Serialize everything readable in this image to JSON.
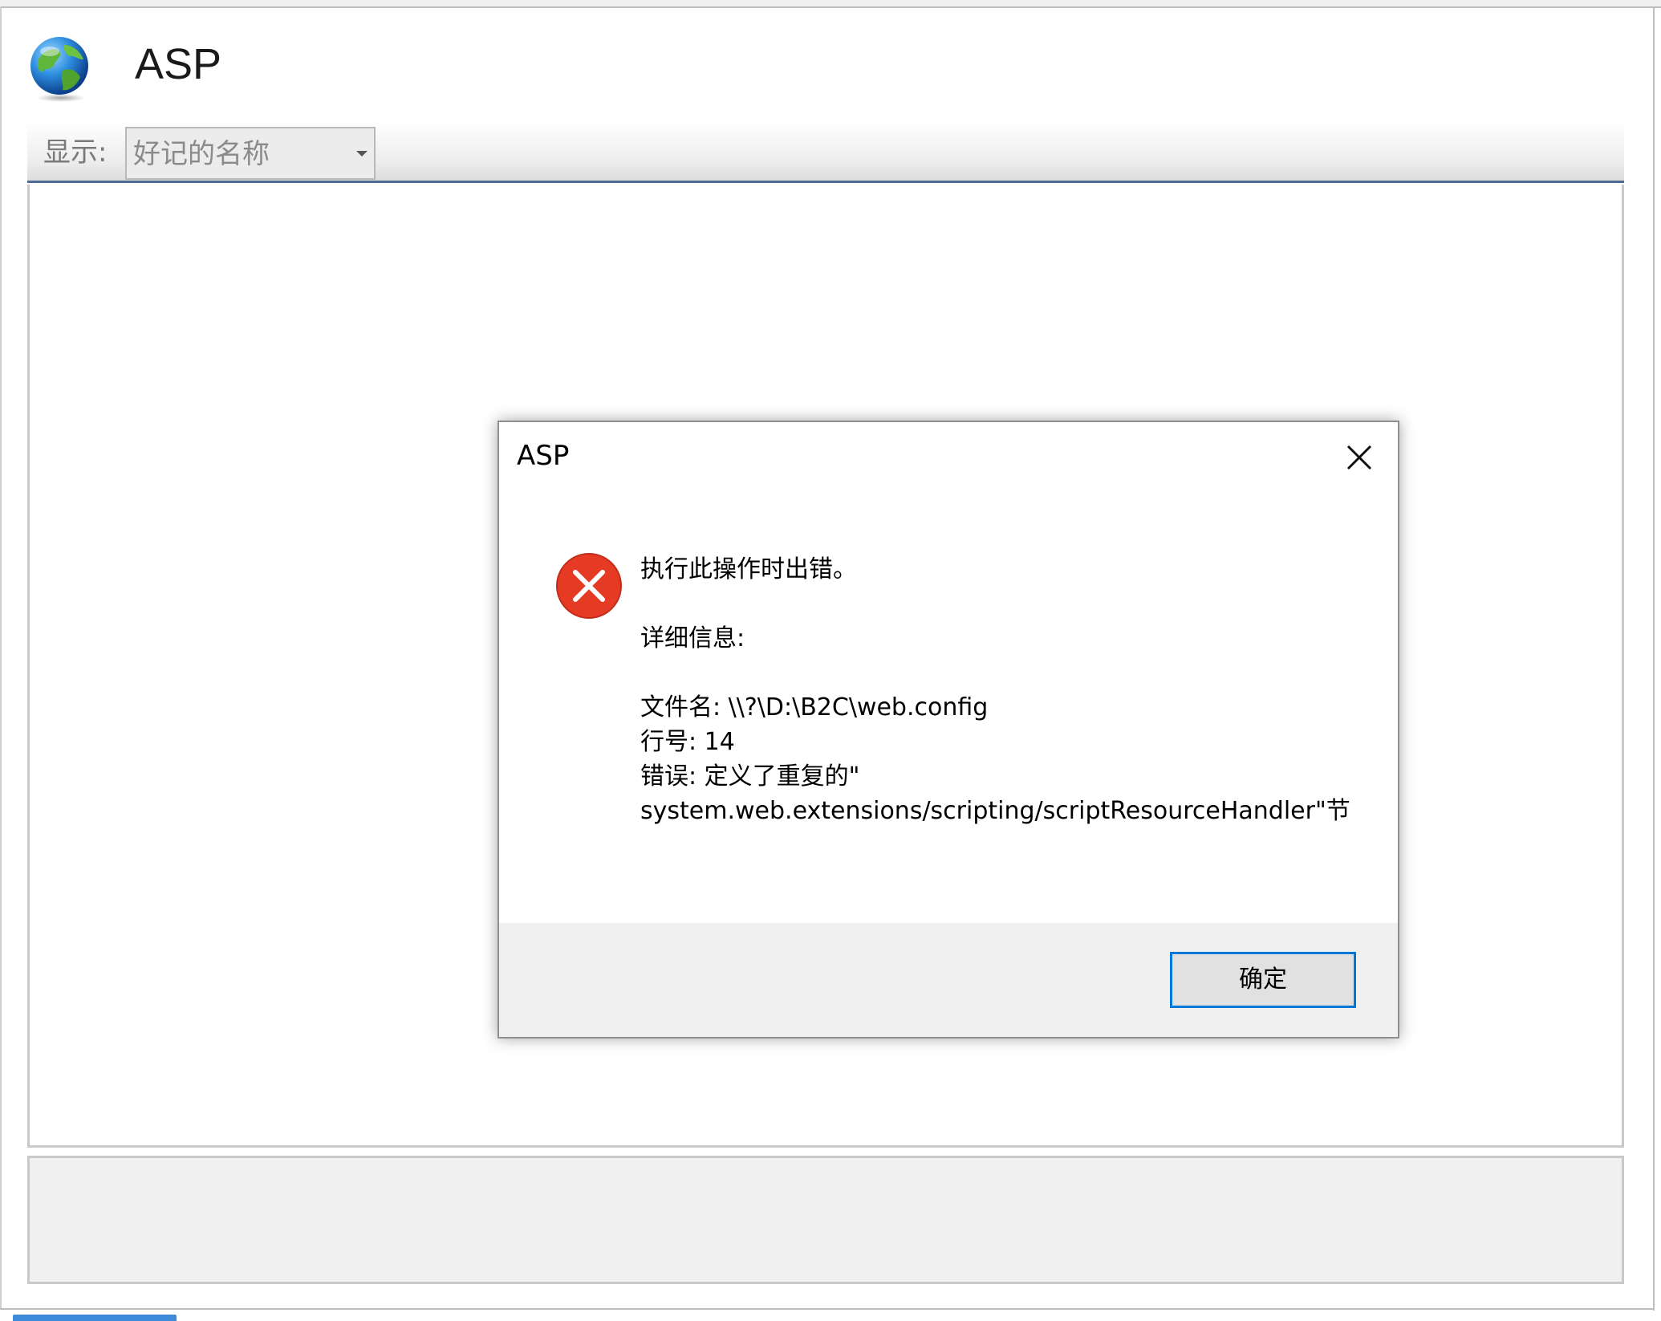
{
  "window": {
    "title": "ASP",
    "icon": "globe-icon"
  },
  "toolbar": {
    "show_label": "显示:",
    "view_select_value": "好记的名称"
  },
  "dialog": {
    "title": "ASP",
    "icon": "error-icon",
    "message": {
      "headline": "执行此操作时出错。",
      "details_label": "详细信息:",
      "filename_line": "文件名: \\\\?\\D:\\B2C\\web.config",
      "line_number_line": "行号: 14",
      "error_line_1": "错误: 定义了重复的\"",
      "error_line_2": "system.web.extensions/scripting/scriptResourceHandler\"节"
    },
    "ok_button_label": "确定"
  },
  "colors": {
    "accent": "#0078d7",
    "error_red": "#e53b24",
    "toolbar_border": "#4e6b94"
  }
}
